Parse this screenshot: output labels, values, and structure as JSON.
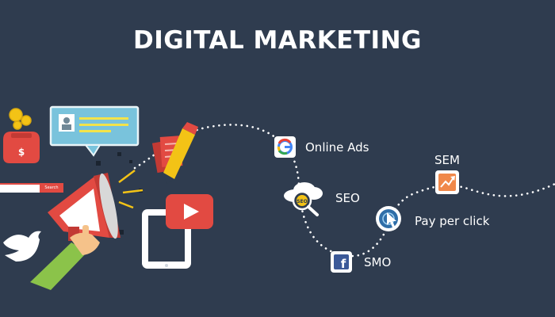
{
  "banner": {
    "title": "DIGITAL MARKETING",
    "colors": {
      "background": "#2f3c4f",
      "text": "#ffffff",
      "accent_red": "#e24a42",
      "accent_green": "#8bc34a",
      "accent_blue": "#3b5998",
      "accent_orange": "#f0884a"
    },
    "search_bar": {
      "button_label": "Search"
    },
    "channels": [
      {
        "label": "Online Ads",
        "icon": "google-icon"
      },
      {
        "label": "SEO",
        "icon": "seo-magnifier-icon"
      },
      {
        "label": "SMO",
        "icon": "facebook-icon"
      },
      {
        "label": "Pay per click",
        "icon": "cursor-click-icon"
      },
      {
        "label": "SEM",
        "icon": "growth-chart-icon"
      }
    ],
    "illustration_icons": [
      "piggy-bank-icon",
      "coin-icon",
      "chat-bubble-icon",
      "megaphone-icon",
      "hand-icon",
      "bird-icon",
      "tablet-icon",
      "play-button-icon",
      "documents-icon",
      "pencil-icon"
    ]
  }
}
